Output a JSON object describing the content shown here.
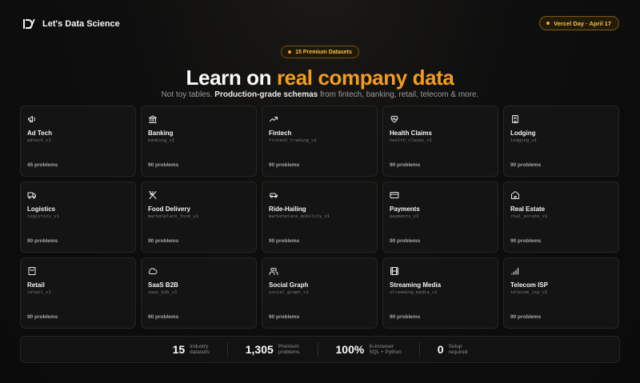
{
  "brand": {
    "name": "Let's Data Science"
  },
  "event_badge": {
    "label": "Vercel Day · April 17"
  },
  "hero": {
    "pill": "15 Premium Datasets",
    "headline_prefix": "Learn on ",
    "headline_accent": "real company data",
    "sub_prefix": "Not toy tables. ",
    "sub_bold": "Production-grade schemas",
    "sub_suffix": " from fintech, banking, retail, telecom & more."
  },
  "datasets": [
    {
      "title": "Ad Tech",
      "slug": "adtech_v1",
      "count": "45 problems",
      "icon": "megaphone-icon"
    },
    {
      "title": "Banking",
      "slug": "banking_v1",
      "count": "90 problems",
      "icon": "bank-icon"
    },
    {
      "title": "Fintech",
      "slug": "fintech_trading_v1",
      "count": "90 problems",
      "icon": "trending-up-icon"
    },
    {
      "title": "Health Claims",
      "slug": "health_claims_v1",
      "count": "90 problems",
      "icon": "heart-pulse-icon"
    },
    {
      "title": "Lodging",
      "slug": "lodging_v1",
      "count": "90 problems",
      "icon": "hotel-icon"
    },
    {
      "title": "Logistics",
      "slug": "logistics_v1",
      "count": "90 problems",
      "icon": "truck-icon"
    },
    {
      "title": "Food Delivery",
      "slug": "marketplace_food_v1",
      "count": "90 problems",
      "icon": "utensils-icon"
    },
    {
      "title": "Ride-Hailing",
      "slug": "marketplace_mobility_v1",
      "count": "90 problems",
      "icon": "car-icon"
    },
    {
      "title": "Payments",
      "slug": "payments_v1",
      "count": "90 problems",
      "icon": "credit-card-icon"
    },
    {
      "title": "Real Estate",
      "slug": "real_estate_v1",
      "count": "90 problems",
      "icon": "house-icon"
    },
    {
      "title": "Retail",
      "slug": "retail_v1",
      "count": "90 problems",
      "icon": "shopping-bag-icon"
    },
    {
      "title": "SaaS B2B",
      "slug": "saas_b2b_v1",
      "count": "90 problems",
      "icon": "cloud-icon"
    },
    {
      "title": "Social Graph",
      "slug": "social_graph_v1",
      "count": "90 problems",
      "icon": "users-icon"
    },
    {
      "title": "Streaming Media",
      "slug": "streaming_media_v1",
      "count": "90 problems",
      "icon": "film-icon"
    },
    {
      "title": "Telecom ISP",
      "slug": "telecom_isp_v1",
      "count": "90 problems",
      "icon": "signal-bars-icon"
    }
  ],
  "stats": [
    {
      "value": "15",
      "label": "Industry\ndatasets"
    },
    {
      "value": "1,305",
      "label": "Premium\nproblems"
    },
    {
      "value": "100%",
      "label": "In-browser\nSQL + Python"
    },
    {
      "value": "0",
      "label": "Setup\nrequired"
    }
  ],
  "colors": {
    "accent": "#f39c1e",
    "badge": "#f2c14e",
    "card_bg": "#141414",
    "page_bg": "#0b0b0b"
  }
}
